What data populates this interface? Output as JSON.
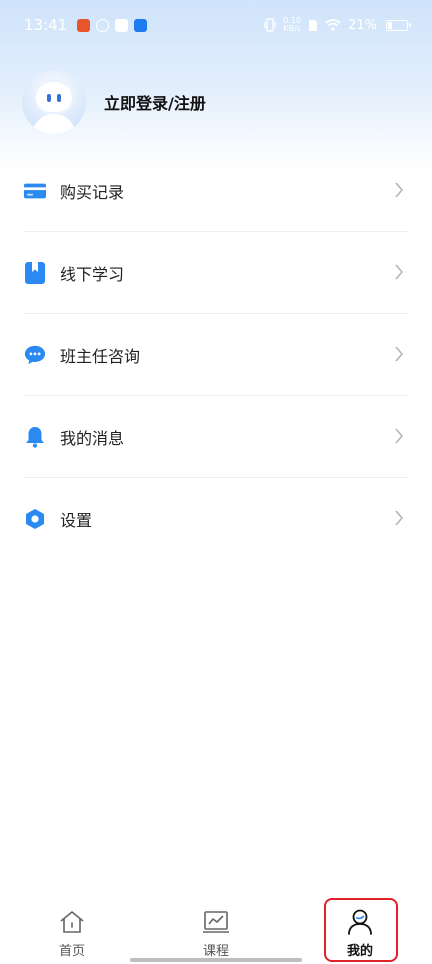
{
  "status_bar": {
    "time": "13:41",
    "net_speed_value": "0.10",
    "net_speed_unit": "KB/s",
    "battery": "21%"
  },
  "profile": {
    "login_label": "立即登录/注册"
  },
  "menu": {
    "items": [
      {
        "label": "购买记录",
        "icon": "card-icon"
      },
      {
        "label": "线下学习",
        "icon": "bookmark-book-icon"
      },
      {
        "label": "班主任咨询",
        "icon": "chat-bubble-icon"
      },
      {
        "label": "我的消息",
        "icon": "bell-icon"
      },
      {
        "label": "设置",
        "icon": "hexagon-settings-icon"
      }
    ]
  },
  "bottom_nav": {
    "items": [
      {
        "label": "首页",
        "icon": "home-icon"
      },
      {
        "label": "课程",
        "icon": "chart-icon"
      },
      {
        "label": "我的",
        "icon": "profile-icon",
        "active": true
      }
    ]
  },
  "colors": {
    "accent": "#2a7ef0",
    "highlight": "#e0202a"
  }
}
